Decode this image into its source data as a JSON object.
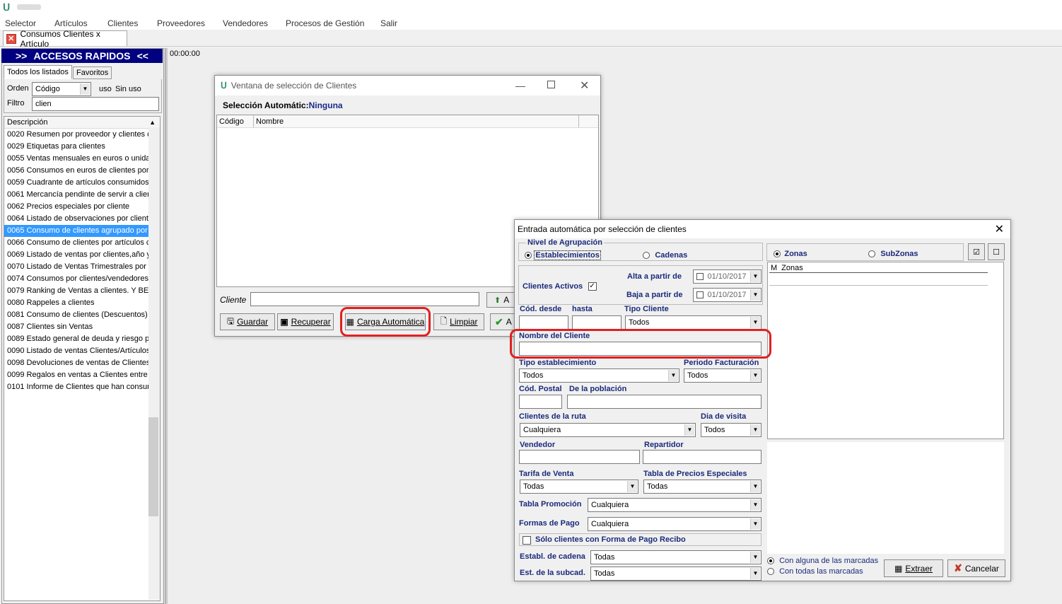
{
  "menu": [
    "Selector",
    "Artículos",
    "Clientes",
    "Proveedores",
    "Vendedores",
    "Procesos de Gestión",
    "Salir"
  ],
  "doc_tab": "Consumos Clientes x Artículo",
  "left": {
    "header_left": ">>",
    "header_title": "ACCESOS RAPIDOS",
    "header_right": "<<",
    "tabs": [
      "Todos los listados",
      "Favoritos"
    ],
    "orden_label": "Orden",
    "orden_value": "Código",
    "uso_label": "uso",
    "uso_value": "Sin uso",
    "filtro_label": "Filtro",
    "filtro_value": "clien",
    "list_header": "Descripción",
    "items": [
      "0020 Resumen por proveedor y clientes c",
      "0029 Etiquetas para clientes",
      "0055 Ventas mensuales en euros o unida",
      "0056 Consumos en euros de clientes por",
      "0059 Cuadrante de artículos consumidos",
      "0061 Mercancía pendinte de servir a clien",
      "0062 Precios especiales por cliente",
      "0064 Listado de observaciones por client",
      "0065 Consumo de clientes agrupado por a",
      "0066 Consumo de clientes por artículos c",
      "0069 Listado de ventas por clientes,año y",
      "0070 Listado de Ventas Trimestrales por",
      "0074 Consumos por clientes/vendedores",
      "0079 Ranking de Ventas a clientes. Y BEI",
      "0080 Rappeles a clientes",
      "0081 Consumo de clientes (Descuentos)",
      "0087 Clientes sin Ventas",
      "0089 Estado general de deuda y riesgo p",
      "0090 Listado de ventas Clientes/Artículos",
      "0098 Devoluciones de ventas de Clientes",
      "0099 Regalos en ventas a Clientes entre",
      "0101 Informe de Clientes que han consum"
    ],
    "selected_index": 8
  },
  "time_display": "00:00:00",
  "sel_window": {
    "title": "Ventana de selección de Clientes",
    "auto_label": "Selección Automátic:",
    "auto_value": "Ninguna",
    "col_codigo": "Código",
    "col_nombre": "Nombre",
    "cliente_label": "Cliente",
    "buttons": {
      "guardar": "Guardar",
      "recuperar": "Recuperar",
      "carga": "Carga Automática",
      "limpiar": "Limpiar",
      "aceptar_partial": "A",
      "aceptar_top_partial": "A"
    }
  },
  "auto_window": {
    "title": "Entrada automática por selección de clientes",
    "nivel_label": "Nivel de Agrupación",
    "establecimientos": "Establecimientos",
    "cadenas": "Cadenas",
    "clientes_activos": "Clientes Activos",
    "alta_label": "Alta a partir de",
    "alta_value": "01/10/2017",
    "baja_label": "Baja a partir de",
    "baja_value": "01/10/2017",
    "cod_desde": "Cód. desde",
    "hasta": "hasta",
    "tipo_cliente_label": "Tipo Cliente",
    "tipo_cliente_value": "Todos",
    "nombre_cliente_label": "Nombre del Cliente",
    "tipo_estab_label": "Tipo establecimiento",
    "tipo_estab_value": "Todos",
    "periodo_label": "Periodo Facturación",
    "periodo_value": "Todos",
    "cod_postal": "Cód. Postal",
    "poblacion": "De la población",
    "ruta_label": "Clientes de la ruta",
    "ruta_value": "Cualquiera",
    "dia_label": "Dia de visita",
    "dia_value": "Todos",
    "vendedor": "Vendedor",
    "repartidor": "Repartidor",
    "tarifa_label": "Tarifa de Venta",
    "tarifa_value": "Todas",
    "tabla_precios_label": "Tabla de Precios Especiales",
    "tabla_precios_value": "Todas",
    "promo_label": "Tabla Promoción",
    "promo_value": "Cualquiera",
    "formas_label": "Formas de Pago",
    "formas_value": "Cualquiera",
    "solo_recibo": "Sólo clientes con Forma de Pago Recibo",
    "cadena_label": "Establ. de cadena",
    "cadena_value": "Todas",
    "subcad_label": "Est. de la subcad.",
    "subcad_value": "Todas",
    "zonas": "Zonas",
    "subzonas": "SubZonas",
    "zonas_col_m": "M",
    "zonas_col_name": "Zonas",
    "con_alguna": "Con alguna de las marcadas",
    "con_todas": "Con todas las marcadas",
    "extraer": "Extraer",
    "cancelar": "Cancelar"
  },
  "colors": {
    "accent": "#000080",
    "selection": "#3399ff",
    "highlight": "#e02020"
  }
}
